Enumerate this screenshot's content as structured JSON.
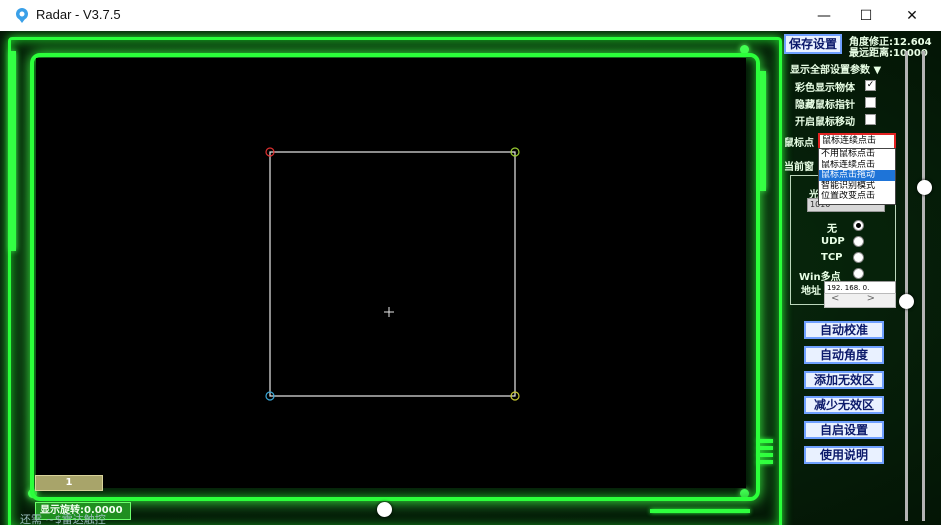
{
  "window": {
    "title": "Radar - V3.7.5",
    "minimize_glyph": "—",
    "maximize_glyph": "☐",
    "close_glyph": "✕"
  },
  "toolbar": {
    "save_button": "保存设置",
    "angle_label": "角度修正:12.604",
    "distance_label": "最远距离:10000"
  },
  "settings": {
    "show_all_label": "显示全部设置参数 ▼",
    "color_objects_label": "彩色显示物体",
    "color_objects_checked": "✓",
    "hide_cursor_label": "隐藏鼠标指针",
    "hide_cursor_checked": "",
    "enable_move_label": "开启鼠标移动",
    "enable_move_checked": "",
    "mouse_point_label": "鼠标点",
    "mouse_point_value": "鼠标连续点击",
    "current_label": "当前窗",
    "dropdown_options": [
      "不用鼠标点击",
      "鼠标连续点击",
      "鼠标点击拖动",
      "智能识别模式",
      "位置改变点击"
    ],
    "dropdown_highlighted": "鼠标点击拖动"
  },
  "network": {
    "title": "光",
    "port_value": "1010",
    "options": [
      {
        "label": "无",
        "selected": true
      },
      {
        "label": "UDP",
        "selected": false
      },
      {
        "label": "TCP",
        "selected": false
      },
      {
        "label": "Win多点",
        "selected": false
      }
    ],
    "address_label": "地址",
    "address_value": "192. 168. 0.",
    "scroll_left": "<",
    "scroll_right": ">"
  },
  "actions": {
    "auto_calibrate": "自动校准",
    "auto_angle": "自动角度",
    "add_invalid_zone": "添加无效区",
    "reduce_invalid_zone": "减少无效区",
    "self_start_settings": "自启设置",
    "instructions": "使用说明"
  },
  "status": {
    "rotation": "显示旋转:0.0000",
    "page_number": "1",
    "below_text": "还需     ~$雷达触控"
  },
  "colors": {
    "accent_green": "#29ff3a",
    "corner_top_left": "#e03030",
    "corner_top_right": "#9acd32",
    "corner_bottom_left": "#3aa8d8",
    "corner_bottom_right": "#c8c832"
  }
}
